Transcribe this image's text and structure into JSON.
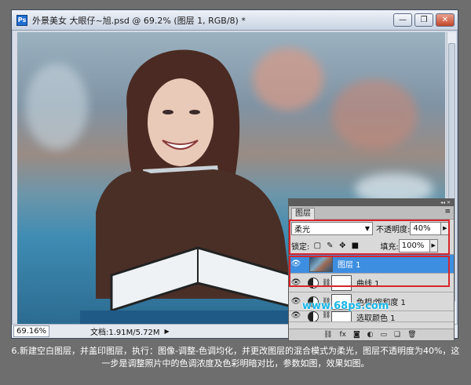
{
  "window": {
    "app_icon_label": "Ps",
    "title": "外景美女 大眼仔~旭.psd @ 69.2% (图层 1, RGB/8) *",
    "controls": {
      "minimize": "—",
      "restore": "❐",
      "close": "✕"
    }
  },
  "statusbar": {
    "zoom": "69.16%",
    "doc_info": "文档:1.91M/5.72M",
    "arrow": "▶"
  },
  "layers_panel": {
    "tab_label": "图层",
    "menu_glyph": "≡",
    "blend_mode": "柔光",
    "opacity_label": "不透明度:",
    "opacity_value": "40%",
    "lock_label": "锁定:",
    "fill_label": "填充:",
    "fill_value": "100%",
    "layers": [
      {
        "name": "图层 1",
        "selected": true
      },
      {
        "name": "曲线 1",
        "selected": false
      },
      {
        "name": "色相/饱和度 1",
        "selected": false
      },
      {
        "name": "选取颜色 1",
        "selected": false
      }
    ],
    "bottom_icons": [
      "link-icon",
      "fx-icon",
      "mask-icon",
      "adjustment-icon",
      "group-icon",
      "new-layer-icon",
      "trash-icon"
    ],
    "highlight_color": "#d8252a"
  },
  "watermark": "www.68ps.com",
  "caption": "6.新建空白图层，并盖印图层，执行：图像-调整-色调均化，并更改图层的混合模式为柔光，图层不透明度为40%，这一步是调整照片中的色调浓度及色彩明暗对比，参数如图，效果如图。"
}
